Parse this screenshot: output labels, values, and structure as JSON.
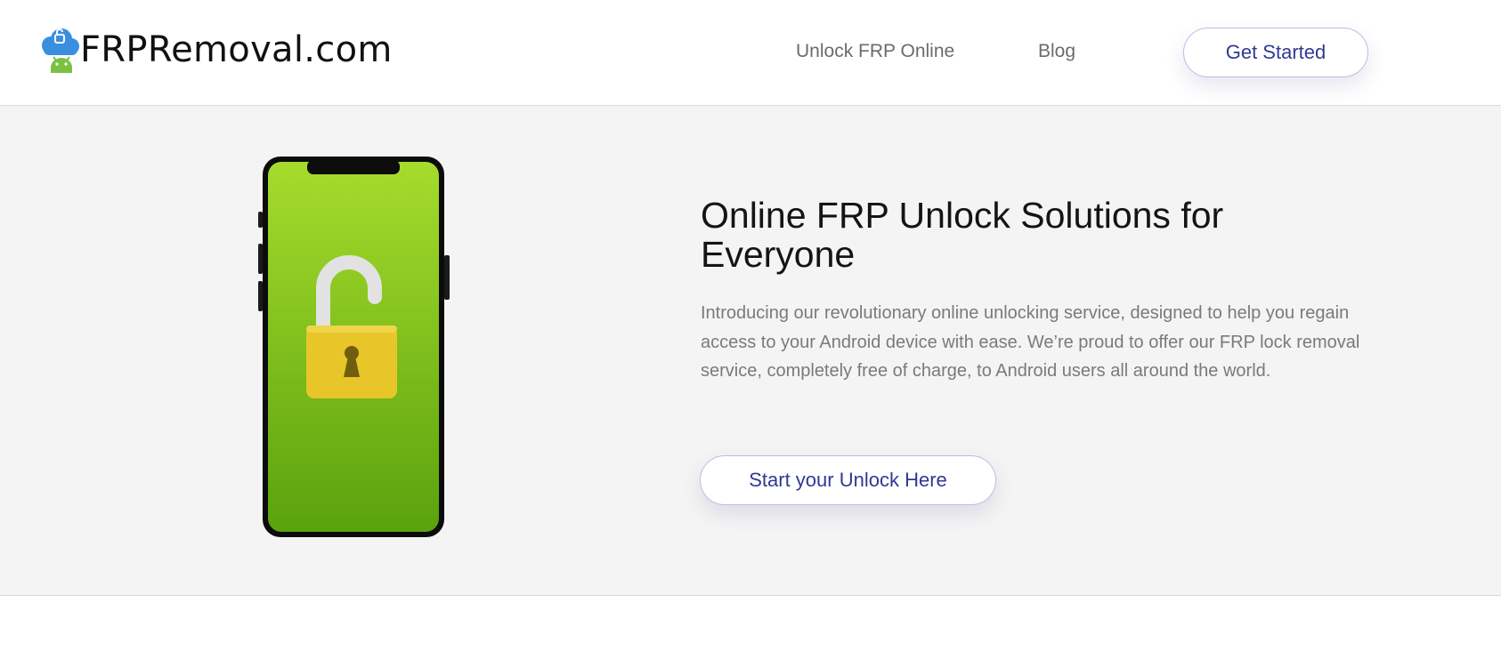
{
  "brand": {
    "name": "FRPRemoval.com",
    "colors": {
      "cloud": "#3a8fe0",
      "robot": "#7bc242"
    }
  },
  "nav": {
    "links": [
      {
        "label": "Unlock FRP Online"
      },
      {
        "label": "Blog"
      }
    ],
    "cta_label": "Get Started"
  },
  "hero": {
    "title": "Online FRP Unlock Solutions for Everyone",
    "description": "Introducing our revolutionary online unlocking service, designed to help you regain access to your Android device with ease. We’re proud to offer our FRP lock removal service, completely free of charge, to Android users all around the world.",
    "cta_label": "Start your Unlock Here",
    "illustration": {
      "icon": "unlocked-padlock",
      "screen_color": "#8fcc22",
      "lock_color": "#e8c62a"
    }
  },
  "colors": {
    "accent": "#2f3a93",
    "hero_background": "#f4f4f4",
    "button_border": "#b9bde3"
  }
}
